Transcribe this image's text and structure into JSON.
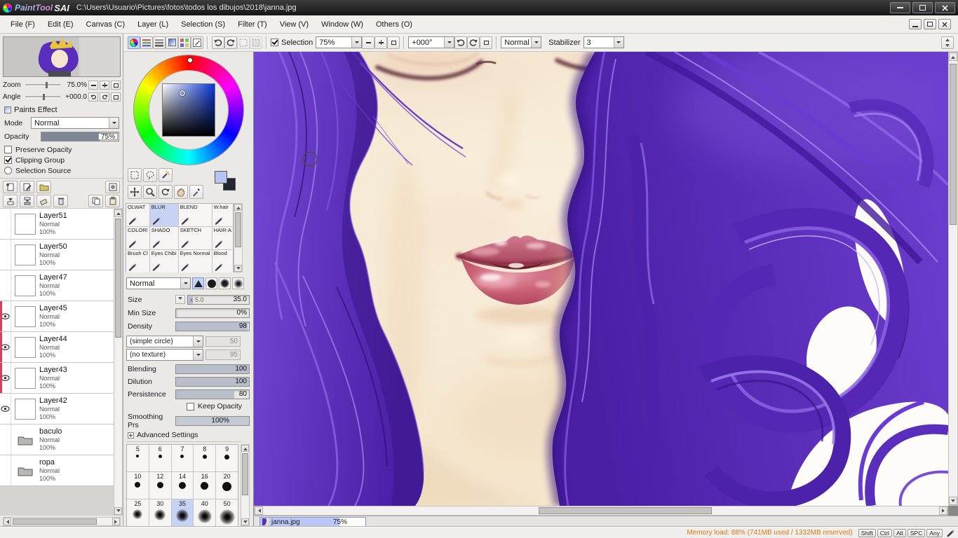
{
  "window": {
    "logo_paint": "PaintTool",
    "logo_sai": "SAI",
    "title": "C:\\Users\\Usuario\\Pictures\\fotos\\todos los dibujos\\2018\\janna.jpg"
  },
  "menu": {
    "items": [
      "File (F)",
      "Edit (E)",
      "Canvas (C)",
      "Layer (L)",
      "Selection (S)",
      "Filter (T)",
      "View (V)",
      "Window (W)",
      "Others (O)"
    ]
  },
  "toolbar": {
    "selection_label": "Selection",
    "zoom_value": "75%",
    "angle_value": "+000°",
    "mode_value": "Normal",
    "stabilizer_label": "Stabilizer",
    "stabilizer_value": "3"
  },
  "navigator": {
    "zoom_label": "Zoom",
    "zoom_value": "75.0%",
    "angle_label": "Angle",
    "angle_value": "+000.0"
  },
  "paints_effect": {
    "title": "Paints Effect",
    "mode_label": "Mode",
    "mode_value": "Normal",
    "opacity_label": "Opacity",
    "opacity_value": "75%",
    "options": [
      {
        "label": "Preserve Opacity",
        "checked": false,
        "is_radio": false
      },
      {
        "label": "Clipping Group",
        "checked": true,
        "is_radio": false
      },
      {
        "label": "Selection Source",
        "checked": false,
        "is_radio": true
      }
    ]
  },
  "layers": [
    {
      "name": "Layer51",
      "mode": "Normal",
      "opacity": "100%",
      "visible": false,
      "folder": false,
      "stripe": false
    },
    {
      "name": "Layer50",
      "mode": "Normal",
      "opacity": "100%",
      "visible": false,
      "folder": false,
      "stripe": false
    },
    {
      "name": "Layer47",
      "mode": "Normal",
      "opacity": "100%",
      "visible": false,
      "folder": false,
      "stripe": false
    },
    {
      "name": "Layer45",
      "mode": "Normal",
      "opacity": "100%",
      "visible": true,
      "folder": false,
      "stripe": true
    },
    {
      "name": "Layer44",
      "mode": "Normal",
      "opacity": "100%",
      "visible": true,
      "folder": false,
      "stripe": true
    },
    {
      "name": "Layer43",
      "mode": "Normal",
      "opacity": "100%",
      "visible": true,
      "folder": false,
      "stripe": true
    },
    {
      "name": "Layer42",
      "mode": "Normal",
      "opacity": "100%",
      "visible": true,
      "folder": false,
      "stripe": false
    },
    {
      "name": "baculo",
      "mode": "Normal",
      "opacity": "100%",
      "visible": false,
      "folder": true,
      "stripe": false
    },
    {
      "name": "ropa",
      "mode": "Normal",
      "opacity": "100%",
      "visible": false,
      "folder": true,
      "stripe": false
    }
  ],
  "color_panel": {
    "current_color": "#b7c3f3",
    "secondary_color": "#232733"
  },
  "brush_panel": {
    "brushes": [
      {
        "name": "OLWAT",
        "selected": false
      },
      {
        "name": "BLUR",
        "selected": true
      },
      {
        "name": "BLEND",
        "selected": false
      },
      {
        "name": "W.hair",
        "selected": false
      },
      {
        "name": "COLOR!",
        "selected": false
      },
      {
        "name": "SHADO",
        "selected": false
      },
      {
        "name": "SKETCH",
        "selected": false
      },
      {
        "name": "HAIR-A",
        "selected": false
      },
      {
        "name": "Brush Cl",
        "selected": false
      },
      {
        "name": "Eyes Chibi",
        "selected": false
      },
      {
        "name": "Eyes Normal",
        "selected": false
      },
      {
        "name": "Blood",
        "selected": false
      }
    ],
    "settings": {
      "mode_value": "Normal",
      "size_label": "Size",
      "size_unit": "x 5.0",
      "size_value": "35.0",
      "min_size_label": "Min Size",
      "min_size_value": "0%",
      "density_label": "Density",
      "density_value": "98",
      "shape_value": "(simple circle)",
      "shape_num": "50",
      "texture_value": "(no texture)",
      "texture_num": "95",
      "blending_label": "Blending",
      "blending_value": "100",
      "dilution_label": "Dilution",
      "dilution_value": "100",
      "persistence_label": "Persistence",
      "persistence_value": "80",
      "keep_opacity_label": "Keep Opacity",
      "smoothing_label": "Smoothing Prs",
      "smoothing_value": "100%",
      "advanced_label": "Advanced Settings"
    },
    "size_presets": [
      {
        "label": "5",
        "dot": 4,
        "soft": false,
        "selected": false
      },
      {
        "label": "6",
        "dot": 5,
        "soft": false,
        "selected": false
      },
      {
        "label": "7",
        "dot": 5,
        "soft": false,
        "selected": false
      },
      {
        "label": "8",
        "dot": 6,
        "soft": false,
        "selected": false
      },
      {
        "label": "9",
        "dot": 7,
        "soft": false,
        "selected": false
      },
      {
        "label": "10",
        "dot": 8,
        "soft": false,
        "selected": false
      },
      {
        "label": "12",
        "dot": 9,
        "soft": false,
        "selected": false
      },
      {
        "label": "14",
        "dot": 10,
        "soft": false,
        "selected": false
      },
      {
        "label": "16",
        "dot": 11,
        "soft": false,
        "selected": false
      },
      {
        "label": "20",
        "dot": 13,
        "soft": false,
        "selected": false
      },
      {
        "label": "25",
        "dot": 14,
        "soft": true,
        "selected": false
      },
      {
        "label": "30",
        "dot": 16,
        "soft": true,
        "selected": false
      },
      {
        "label": "35",
        "dot": 18,
        "soft": true,
        "selected": true
      },
      {
        "label": "40",
        "dot": 20,
        "soft": true,
        "selected": false
      },
      {
        "label": "50",
        "dot": 22,
        "soft": true,
        "selected": false
      }
    ]
  },
  "canvas": {
    "tab_name": "janna.jpg",
    "tab_zoom": "75%"
  },
  "status": {
    "memory": "Memory load: 88% (741MB used / 1332MB reserved)",
    "keys": [
      "Shift",
      "Ctrl",
      "Alt",
      "SPC",
      "Any"
    ]
  },
  "colors": {
    "selection": "#c7d3f5",
    "hair": "#5527b5",
    "skin": "#f5e8d1",
    "lips": "#c05268",
    "memory_text": "#e07818",
    "current_color": "#b7c3f3"
  }
}
